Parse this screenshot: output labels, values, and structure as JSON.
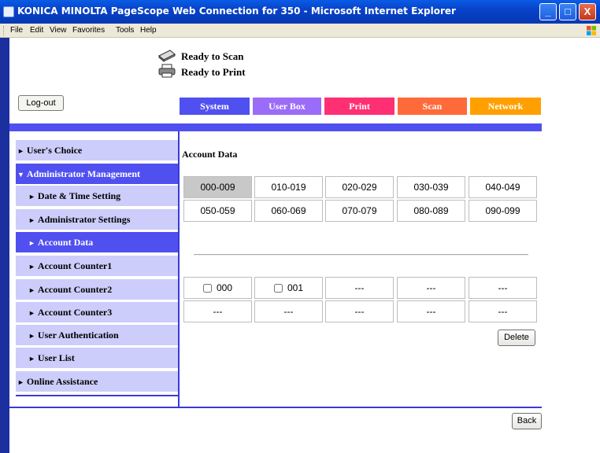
{
  "window": {
    "title": "KONICA MINOLTA PageScope Web Connection for 350 - Microsoft Internet Explorer",
    "controls": {
      "minimize": "_",
      "maximize": "□",
      "close": "X"
    }
  },
  "menu": [
    "File",
    "Edit",
    "View",
    "Favorites",
    "Tools",
    "Help"
  ],
  "status": {
    "scan": "Ready to Scan",
    "print": "Ready to Print"
  },
  "logout_label": "Log-out",
  "tabs": [
    {
      "label": "System",
      "color": "#5050f0"
    },
    {
      "label": "User Box",
      "color": "#9b6cf7"
    },
    {
      "label": "Print",
      "color": "#ff2f73"
    },
    {
      "label": "Scan",
      "color": "#ff6a3a"
    },
    {
      "label": "Network",
      "color": "#ffa000"
    }
  ],
  "sidebar": {
    "items": [
      {
        "label": "User's Choice",
        "arrow": "►"
      },
      {
        "label": "Administrator Management",
        "arrow": "▼"
      },
      {
        "label": "Date & Time Setting",
        "arrow": "►"
      },
      {
        "label": "Administrator Settings",
        "arrow": "►"
      },
      {
        "label": "Account Data",
        "arrow": "►"
      },
      {
        "label": "Account Counter1",
        "arrow": "►"
      },
      {
        "label": "Account Counter2",
        "arrow": "►"
      },
      {
        "label": "Account Counter3",
        "arrow": "►"
      },
      {
        "label": "User Authentication",
        "arrow": "►"
      },
      {
        "label": "User List",
        "arrow": "►"
      },
      {
        "label": "Online Assistance",
        "arrow": "►"
      }
    ]
  },
  "main": {
    "title": "Account Data",
    "ranges": [
      [
        "000-009",
        "010-019",
        "020-029",
        "030-039",
        "040-049"
      ],
      [
        "050-059",
        "060-069",
        "070-079",
        "080-089",
        "090-099"
      ]
    ],
    "accounts": [
      [
        "000",
        "001",
        "---",
        "---",
        "---"
      ],
      [
        "---",
        "---",
        "---",
        "---",
        "---"
      ]
    ],
    "delete_label": "Delete",
    "back_label": "Back"
  }
}
